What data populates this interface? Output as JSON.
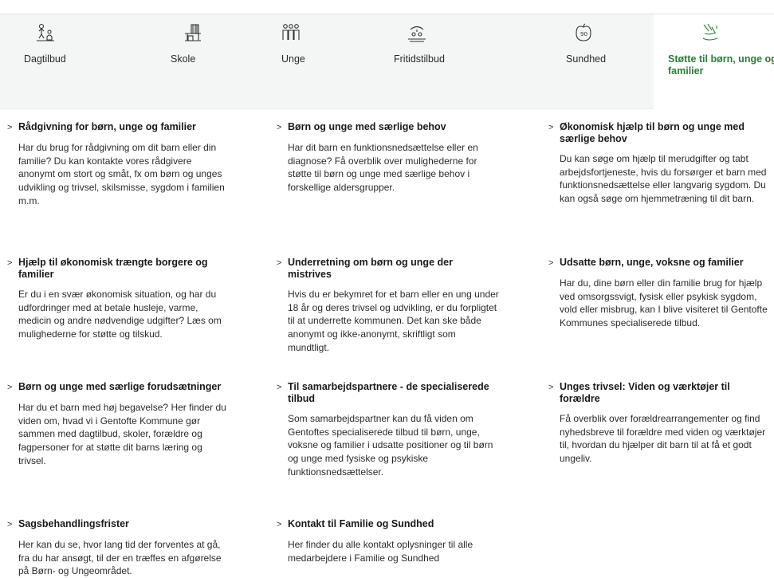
{
  "nav": {
    "tabs": [
      {
        "label": "Dagtilbud",
        "icon": "childcare-icon"
      },
      {
        "label": "Skole",
        "icon": "school-icon"
      },
      {
        "label": "Unge",
        "icon": "youth-icon"
      },
      {
        "label": "Fritidstilbud",
        "icon": "leisure-icon"
      },
      {
        "label": "Sundhed",
        "icon": "health-icon"
      },
      {
        "label": "Støtte til børn, unge og familier",
        "icon": "support-icon"
      }
    ],
    "active_color": "#2f7a3a"
  },
  "items": [
    {
      "title": "Rådgivning for børn, unge og familier",
      "desc": "Har du brug for rådgivning om dit barn eller din familie? Du kan kontakte vores rådgivere anonymt om stort og småt, fx om børn og unges udvikling og trivsel, skilsmisse, sygdom i familien m.m."
    },
    {
      "title": "Børn og unge med særlige behov",
      "desc": "Har dit barn en funktionsnedsættelse eller en diagnose? Få overblik over mulighederne for støtte til børn og unge med særlige behov i forskellige aldersgrupper."
    },
    {
      "title": "Økonomisk hjælp til børn og unge med særlige behov",
      "desc": "Du kan søge om hjælp til merudgifter og tabt arbejdsfortjeneste, hvis du forsørger et barn med funktionsnedsættelse eller langvarig sygdom. Du kan også søge om hjemmetræning til dit barn."
    },
    {
      "title": "Hjælp til økonomisk trængte borgere og familier",
      "desc": "Er du i en svær økonomisk situation, og har du udfordringer med at betale husleje, varme, medicin og andre nødvendige udgifter? Læs om mulighederne for støtte og tilskud."
    },
    {
      "title": "Underretning om børn og unge der mistrives",
      "desc": "Hvis du er bekymret for et barn eller en ung under 18 år og deres trivsel og udvikling, er du forpligtet til at underrette kommunen. Det kan ske både anonymt og ikke-anonymt, skriftligt som mundtligt."
    },
    {
      "title": "Udsatte børn, unge, voksne og familier",
      "desc": "Har du, dine børn eller din familie brug for hjælp ved omsorgssvigt, fysisk eller psykisk sygdom, vold eller misbrug, kan I blive visiteret til Gentofte Kommunes specialiserede tilbud."
    },
    {
      "title": "Børn og unge med særlige forudsætninger",
      "desc": "Har du et barn med høj begavelse? Her finder du viden om, hvad vi i Gentofte Kommune gør sammen med dagtilbud, skoler, forældre og fagpersoner for at støtte dit barns læring og trivsel."
    },
    {
      "title": "Til samarbejdspartnere - de specialiserede tilbud",
      "desc": "Som samarbejdspartner kan du få viden om Gentoftes specialiserede tilbud til børn, unge, voksne og familier i udsatte positioner og til børn og unge med fysiske og psykiske funktionsnedsættelser."
    },
    {
      "title": "Unges trivsel: Viden og værktøjer til forældre",
      "desc": "Få overblik over forældrearrangementer og find nyhedsbreve til forældre med viden og værktøjer til, hvordan du hjælper dit barn til at få et godt ungeliv."
    },
    {
      "title": "Sagsbehandlingsfrister",
      "desc": "Her kan du se, hvor lang tid der forventes at gå, fra du har ansøgt, til der en træffes en afgørelse på Børn- og Ungeområdet."
    },
    {
      "title": "Kontakt til Familie og Sundhed",
      "desc": "Her finder du alle kontakt oplysninger til alle medarbejdere i Familie og Sundhed"
    }
  ],
  "chevron": ">"
}
